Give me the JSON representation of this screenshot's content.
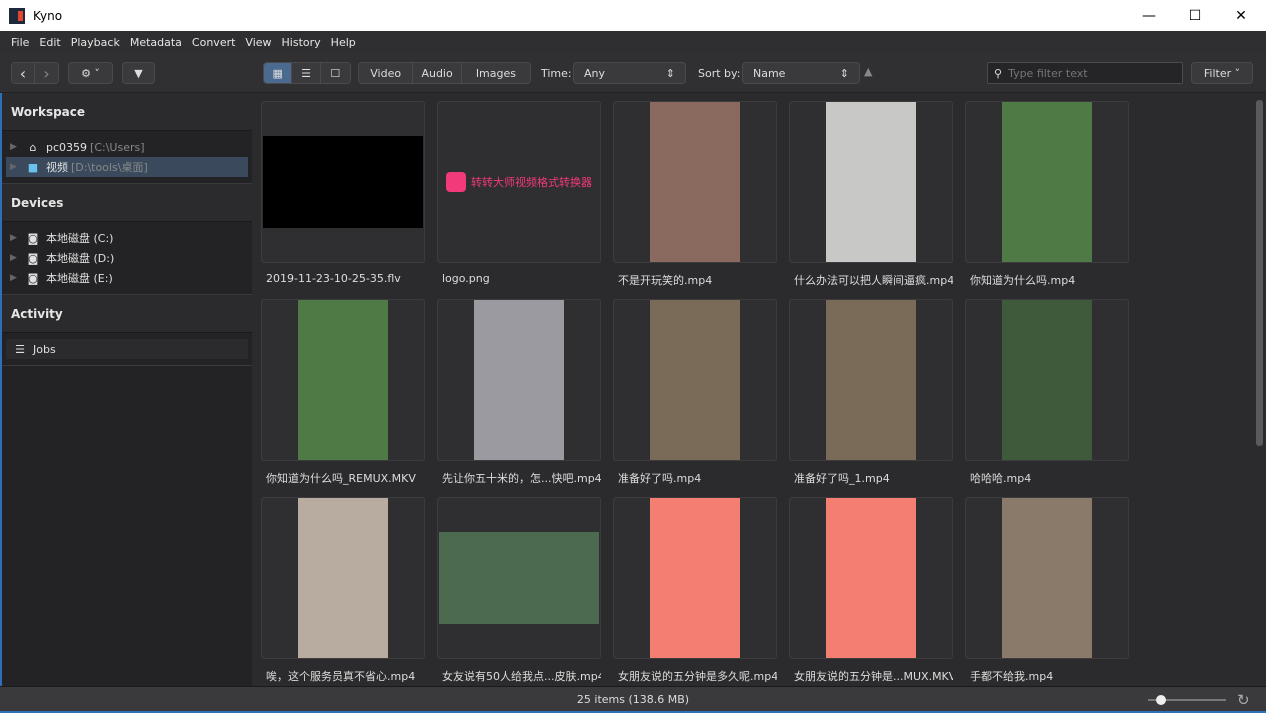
{
  "window": {
    "title": "Kyno",
    "minimize": "—",
    "maximize": "☐",
    "close": "✕"
  },
  "menu": [
    "File",
    "Edit",
    "Playback",
    "Metadata",
    "Convert",
    "View",
    "History",
    "Help"
  ],
  "toolbar": {
    "back": "‹",
    "forward": "›",
    "gear": "⚙ ˅",
    "video": "Video",
    "audio": "Audio",
    "images": "Images",
    "time_label": "Time:",
    "time_value": "Any",
    "sort_label": "Sort by:",
    "sort_value": "Name",
    "filter_placeholder": "Type filter text",
    "filter_button": "Filter ˅"
  },
  "sidebar": {
    "workspace": "Workspace",
    "workspace_items": [
      {
        "name": "pc0359",
        "path": "[C:\\Users]"
      },
      {
        "name": "视频",
        "path": "[D:\\tools\\桌面]"
      }
    ],
    "devices": "Devices",
    "device_items": [
      "本地磁盘 (C:)",
      "本地磁盘 (D:)",
      "本地磁盘 (E:)"
    ],
    "activity": "Activity",
    "jobs": "Jobs"
  },
  "items": [
    {
      "name": "2019-11-23-10-25-35.flv",
      "thumb": "#000000",
      "shape": "wide"
    },
    {
      "name": "logo.png",
      "thumb": "logo",
      "caption": "转转大师视频格式转换器"
    },
    {
      "name": "不是开玩笑的.mp4",
      "thumb": "#8a6a5e",
      "shape": "pic"
    },
    {
      "name": "什么办法可以把人瞬间逼疯.mp4",
      "thumb": "#c8c8c6",
      "shape": "pic"
    },
    {
      "name": "你知道为什么吗.mp4",
      "thumb": "#4f7a45",
      "shape": "pic"
    },
    {
      "name": "你知道为什么吗_REMUX.MKV",
      "thumb": "#4f7a45",
      "shape": "pic"
    },
    {
      "name": "先让你五十米的，怎...快吧.mp4",
      "thumb": "#9a9aa0",
      "shape": "pic"
    },
    {
      "name": "准备好了吗.mp4",
      "thumb": "#7a6a58",
      "shape": "pic"
    },
    {
      "name": "准备好了吗_1.mp4",
      "thumb": "#7a6a58",
      "shape": "pic"
    },
    {
      "name": "哈哈哈.mp4",
      "thumb": "#3e5a3a",
      "shape": "pic"
    },
    {
      "name": "唉，这个服务员真不省心.mp4",
      "thumb": "#b8aca0",
      "shape": "pic"
    },
    {
      "name": "女友说有50人给我点...皮肤.mp4",
      "thumb": "#4c6a50",
      "shape": "wide"
    },
    {
      "name": "女朋友说的五分钟是多久呢.mp4",
      "thumb": "#f47e72",
      "shape": "pic"
    },
    {
      "name": "女朋友说的五分钟是...MUX.MKV",
      "thumb": "#f47e72",
      "shape": "pic"
    },
    {
      "name": "手都不给我.mp4",
      "thumb": "#8a7a6a",
      "shape": "pic"
    }
  ],
  "status": "25 items (138.6 MB)",
  "zoom_level": 0.1,
  "colors": {
    "accent": "#2f6fb5",
    "selected": "#3a4a5c"
  }
}
